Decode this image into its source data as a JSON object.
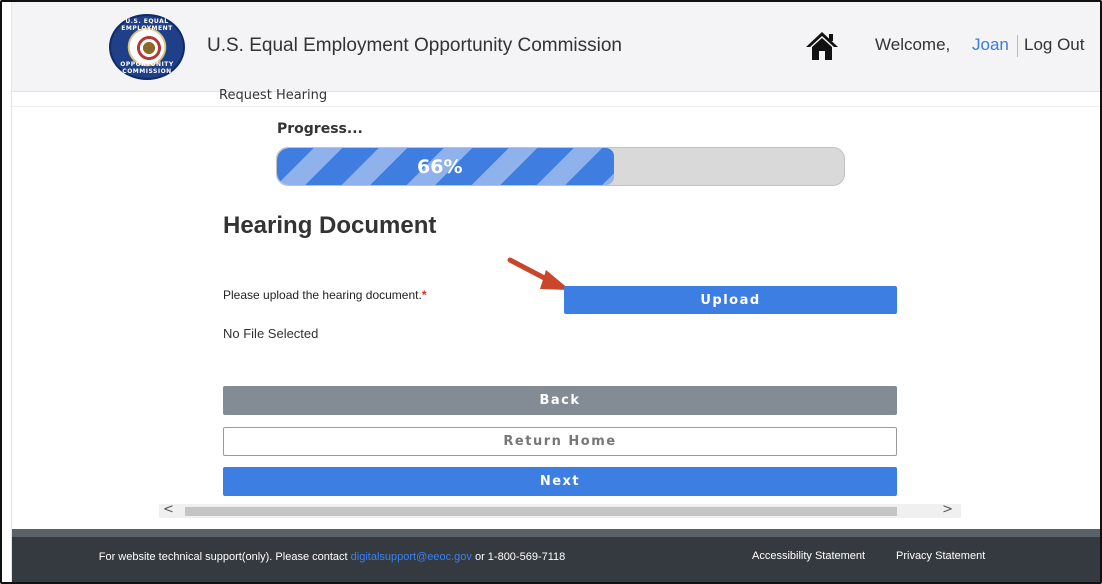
{
  "header": {
    "agency_title": "U.S. Equal Employment Opportunity Commission",
    "seal_text_top": "U.S. EQUAL EMPLOYMENT",
    "seal_text_bottom": "OPPORTUNITY COMMISSION",
    "home_icon": "home-icon",
    "welcome_label": "Welcome,",
    "user_name": "Joan",
    "logout_label": "Log Out"
  },
  "breadcrumb": "Request Hearing",
  "progress": {
    "label": "Progress...",
    "percent": 66,
    "percent_text": "66%",
    "fill_color": "#3f7de0",
    "stripe_color": "#8fb1ec"
  },
  "main": {
    "heading": "Hearing Document",
    "upload_prompt": "Please upload the hearing document.",
    "required_marker": "*",
    "upload_button": "Upload",
    "file_status": "No File Selected",
    "back_button": "Back",
    "return_home_button": "Return Home",
    "next_button": "Next",
    "annotation_icon": "arrow-icon",
    "accent_color": "#3d7ee3"
  },
  "scrollbar": {
    "left_arrow": "<",
    "right_arrow": ">"
  },
  "footer": {
    "support_prefix": "For website technical support(only). Please contact",
    "support_email": "digitalsupport@eeoc.gov",
    "support_phone": "or 1-800-569-7118",
    "accessibility_link": "Accessibility Statement",
    "privacy_link": "Privacy Statement"
  }
}
